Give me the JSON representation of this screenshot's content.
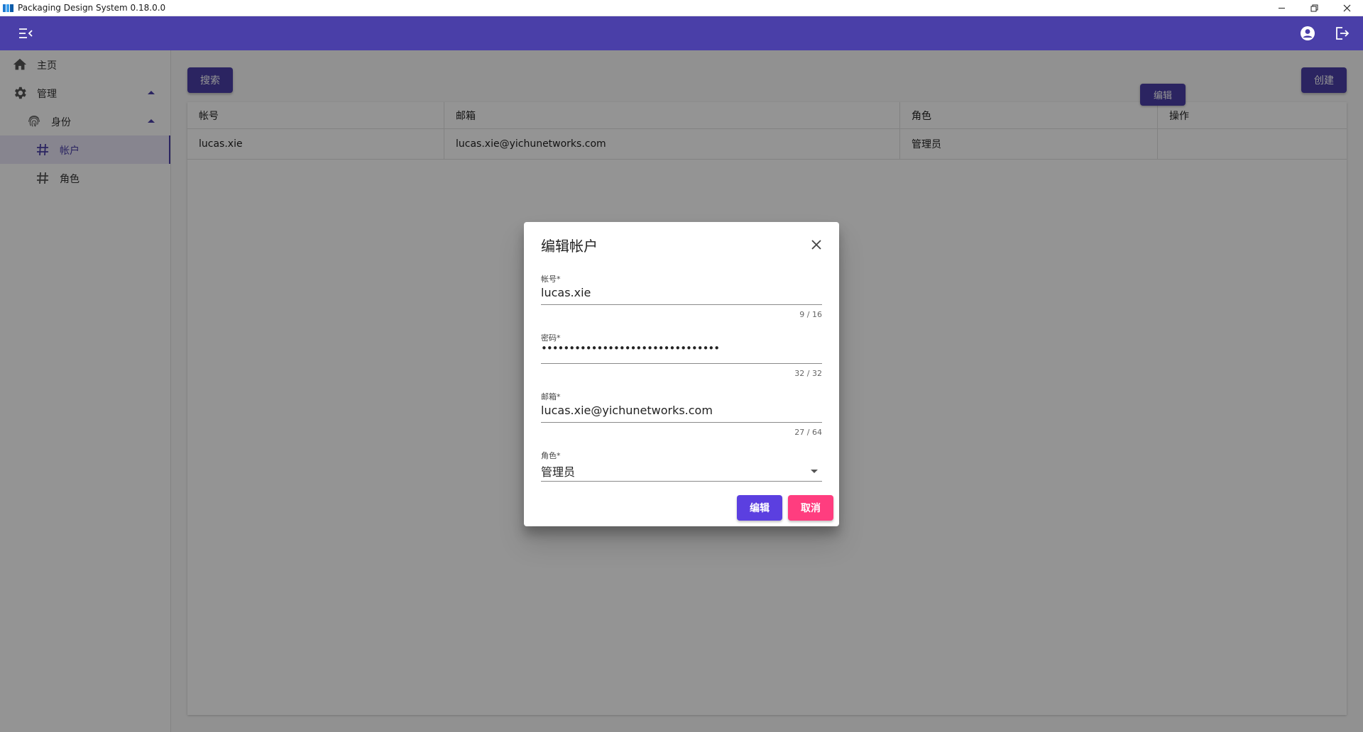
{
  "window": {
    "title": "Packaging Design System 0.18.0.0",
    "controls": [
      "minimize-icon",
      "restore-icon",
      "close-icon"
    ]
  },
  "colors": {
    "primary": "#4a3fa8",
    "accent": "#ff3d7f",
    "dialog_primary": "#5b3fe0"
  },
  "header": {
    "icons": [
      "menu-collapse-icon",
      "account-circle-icon",
      "logout-icon"
    ]
  },
  "sidebar": {
    "items": [
      {
        "label": "主页",
        "icon": "home-icon"
      },
      {
        "label": "管理",
        "icon": "gear-icon"
      },
      {
        "label": "身份",
        "icon": "fingerprint-icon"
      },
      {
        "label": "帐户",
        "icon": "hash-icon"
      },
      {
        "label": "角色",
        "icon": "hash-icon"
      }
    ]
  },
  "toolbar": {
    "search_label": "搜索",
    "create_label": "创建"
  },
  "table": {
    "columns": [
      "帐号",
      "邮箱",
      "角色",
      "操作"
    ],
    "rows": [
      {
        "account": "lucas.xie",
        "email": "lucas.xie@yichunetworks.com",
        "role": "管理员",
        "action_label": "编辑"
      }
    ]
  },
  "dialog": {
    "title": "编辑帐户",
    "fields": {
      "account": {
        "label": "帐号*",
        "value": "lucas.xie",
        "count": "9 / 16"
      },
      "password": {
        "label": "密码*",
        "value": "••••••••••••••••••••••••••••••••",
        "count": "32 / 32"
      },
      "email": {
        "label": "邮箱*",
        "value": "lucas.xie@yichunetworks.com",
        "count": "27 / 64"
      },
      "role": {
        "label": "角色*",
        "value": "管理员"
      }
    },
    "confirm_label": "编辑",
    "cancel_label": "取消"
  }
}
